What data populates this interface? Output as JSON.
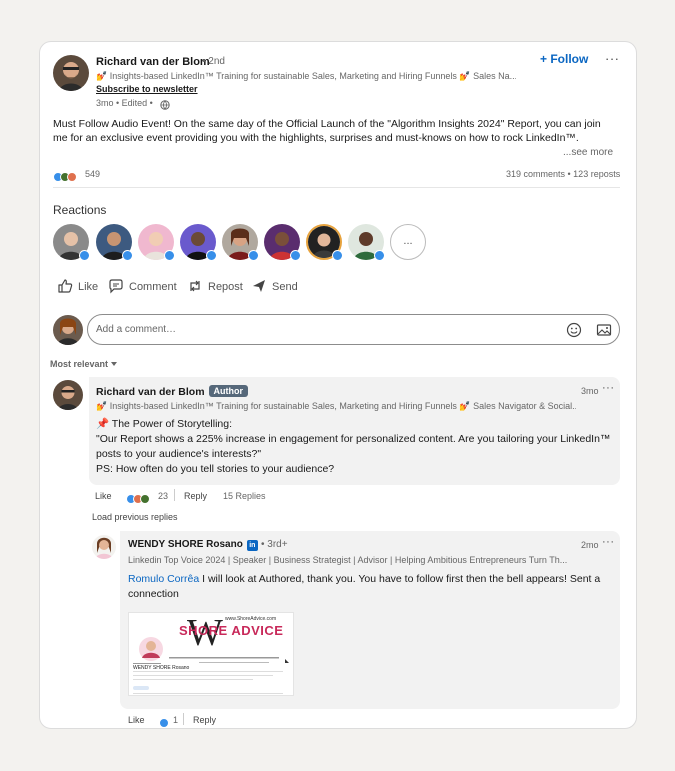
{
  "post": {
    "author_name": "Richard van der Blom",
    "connection_degree": "• 2nd",
    "headline": "💅 Insights-based LinkedIn™ Training for sustainable Sales, Marketing and Hiring Funnels 💅 Sales Na...",
    "newsletter_link": "Subscribe to newsletter",
    "timestamp": "3mo • Edited •",
    "follow_label": "+ Follow",
    "more_label": "···",
    "body_line1": "Must Follow Audio Event! On the same day of the Official Launch of the \"Algorithm Insights 2024\" Report, you can join",
    "body_line2": "me for an exclusive event providing you with the highlights, surprises and must-knows on how to rock LinkedIn™.",
    "see_more": "...see more",
    "reaction_count": "549",
    "comments_reposts": "319 comments • 123 reposts"
  },
  "reactions_section": {
    "title": "Reactions",
    "more_label": "..."
  },
  "actions": {
    "like": "Like",
    "comment": "Comment",
    "repost": "Repost",
    "send": "Send"
  },
  "comment_box": {
    "placeholder": "Add a comment…"
  },
  "sort": {
    "label": "Most relevant"
  },
  "comment1": {
    "author_name": "Richard van der Blom",
    "author_badge": "Author",
    "headline": "💅 Insights-based LinkedIn™ Training for sustainable Sales, Marketing and Hiring Funnels 💅 Sales Navigator & Social...",
    "time": "3mo",
    "more_label": "···",
    "line1": "📌 The Power of Storytelling:",
    "line2": "\"Our Report shows a 225% increase in engagement for personalized content. Are you tailoring your LinkedIn™",
    "line3": "posts to your audience's interests?\"",
    "line4": "PS: How often do you tell stories to your audience?",
    "like": "Like",
    "reaction_count": "23",
    "reply": "Reply",
    "replies_count": "15 Replies"
  },
  "load_previous": "Load previous replies",
  "reply1": {
    "author_name": "WENDY SHORE Rosano",
    "li_badge": "in",
    "degree": "• 3rd+",
    "headline": "Linkedin Top Voice 2024 | Speaker | Business Strategist | Advisor | Helping Ambitious Entrepreneurs Turn Th...",
    "time": "2mo",
    "more_label": "···",
    "mention": "Romulo Corrêa",
    "text_line1": " I will look at Authored, thank you. You have to follow first then the bell appears! Sent a",
    "text_line2": "connection",
    "image_brand": "SHORE ADVICE",
    "image_url_text": "www.ShoreAdvice.com",
    "image_name": "WENDY SHORE Rosano",
    "like": "Like",
    "reaction_count": "1",
    "reply": "Reply"
  },
  "colors": {
    "accent": "#0a66c2",
    "like_blue": "#378fe9",
    "celebrate_green": "#44712e",
    "love_red": "#df704d"
  }
}
